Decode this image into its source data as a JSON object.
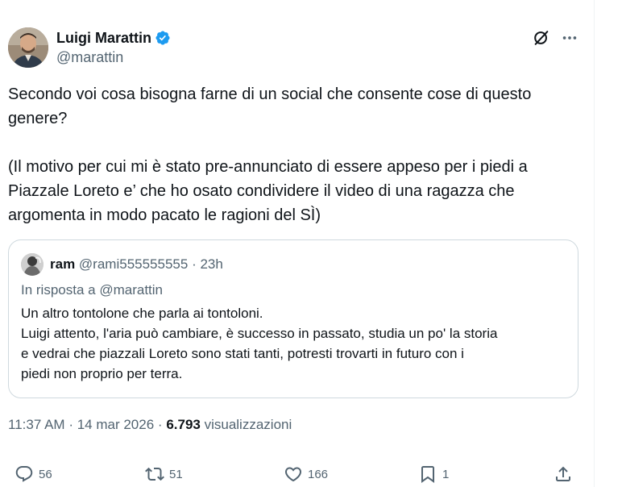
{
  "author": {
    "name": "Luigi Marattin",
    "handle": "@marattin"
  },
  "tweet": {
    "line1": "Secondo voi cosa bisogna farne di un social che consente cose di questo",
    "line2": "genere?",
    "line3": "(Il motivo per cui mi è stato pre-annunciato di essere appeso per i piedi a",
    "line4": "Piazzale Loreto e’ che ho osato condividere il video di una ragazza che",
    "line5": "argomenta in modo pacato le ragioni del SÌ)"
  },
  "quote": {
    "name": "ram",
    "handle": "@rami555555555",
    "separator": "·",
    "time": "23h",
    "reply_to": "In risposta a @marattin",
    "line1": "Un altro tontolone che parla ai tontoloni.",
    "line2": "Luigi attento, l'aria può cambiare, è successo in passato, studia un po' la storia",
    "line3": "e vedrai che piazzali Loreto sono stati tanti, potresti trovarti in futuro con i",
    "line4": "piedi non proprio per terra."
  },
  "meta": {
    "time": "11:37 AM",
    "sep1": "·",
    "date": "14 mar 2026",
    "sep2": "·",
    "views_count": "6.793",
    "views_label": "visualizzazioni"
  },
  "actions": {
    "replies": "56",
    "reposts": "51",
    "likes": "166",
    "bookmarks": "1"
  },
  "colors": {
    "text": "#0f1419",
    "secondary": "#536471",
    "border": "#cfd9de",
    "verified": "#1d9bf0"
  },
  "icons": [
    "verified-badge-icon",
    "grok-icon",
    "more-icon",
    "reply-icon",
    "repost-icon",
    "like-icon",
    "bookmark-icon",
    "share-icon"
  ]
}
